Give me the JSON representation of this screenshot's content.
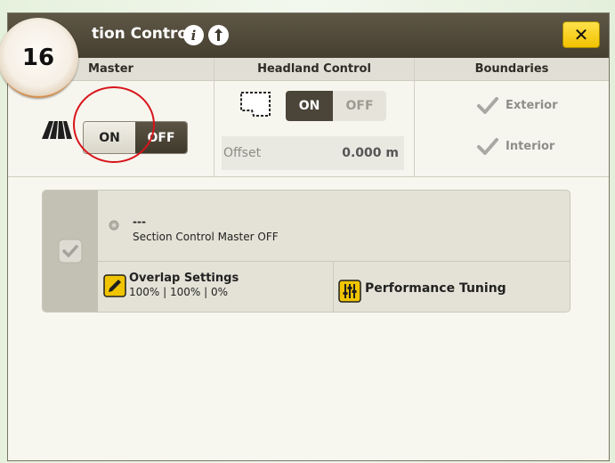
{
  "window": {
    "title": "tion Control",
    "close_label": "✕"
  },
  "badge": {
    "number": "16"
  },
  "panels": {
    "master": {
      "header": "Master",
      "on_label": "ON",
      "off_label": "OFF"
    },
    "headland": {
      "header": "Headland Control",
      "on_label": "ON",
      "off_label": "OFF",
      "offset_label": "Offset",
      "offset_value": "0.000 m"
    },
    "boundaries": {
      "header": "Boundaries",
      "exterior_label": "Exterior",
      "interior_label": "Interior"
    }
  },
  "card": {
    "status_title": "---",
    "status_text": "Section Control Master OFF",
    "overlap_title": "Overlap Settings",
    "overlap_values": "100% | 100% | 0%",
    "tuning_label": "Performance Tuning"
  },
  "colors": {
    "titlebar": "#4f4838",
    "close_button": "#f2c200",
    "highlight_ring": "#d8141b",
    "badge_ring": "#d9833f",
    "toggle_active": "#4a4538",
    "toggle_inactive": "#e6e4da"
  }
}
